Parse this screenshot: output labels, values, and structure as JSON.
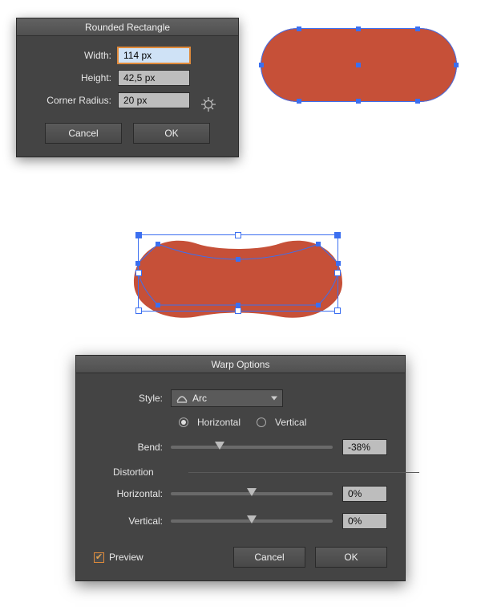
{
  "dialog1": {
    "title": "Rounded Rectangle",
    "width_label": "Width:",
    "width_value": "114 px",
    "height_label": "Height:",
    "height_value": "42,5 px",
    "corner_label": "Corner Radius:",
    "corner_value": "20 px",
    "cancel": "Cancel",
    "ok": "OK"
  },
  "shape1": {
    "fill": "#c65038",
    "selection_color": "#3b6ff0"
  },
  "shape2": {
    "fill": "#c65038",
    "selection_color": "#3b6ff0"
  },
  "dialog2": {
    "title": "Warp Options",
    "style_label": "Style:",
    "style_value": "Arc",
    "orient_horizontal": "Horizontal",
    "orient_vertical": "Vertical",
    "orient_checked": "horizontal",
    "bend_label": "Bend:",
    "bend_value": "-38%",
    "bend_pos_pct": 30,
    "distortion_label": "Distortion",
    "dist_h_label": "Horizontal:",
    "dist_h_value": "0%",
    "dist_h_pos_pct": 50,
    "dist_v_label": "Vertical:",
    "dist_v_value": "0%",
    "dist_v_pos_pct": 50,
    "preview_label": "Preview",
    "preview_checked": true,
    "cancel": "Cancel",
    "ok": "OK"
  }
}
